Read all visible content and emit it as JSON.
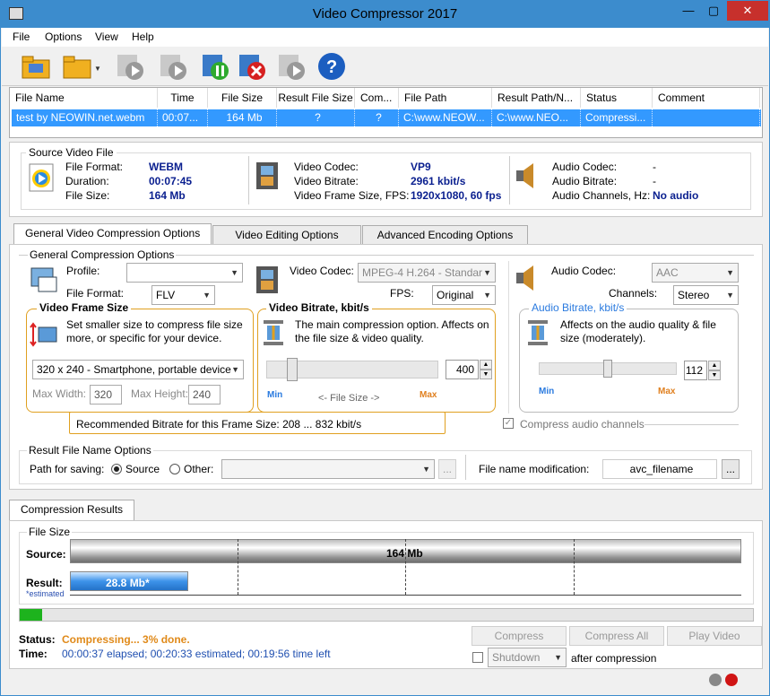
{
  "window": {
    "title": "Video Compressor 2017",
    "minimize": "—",
    "maximize": "▢",
    "close": "✕"
  },
  "menu": [
    "File",
    "Options",
    "View",
    "Help"
  ],
  "grid": {
    "columns": [
      "File Name",
      "Time",
      "File Size",
      "Result File Size",
      "Com...",
      "File Path",
      "Result Path/N...",
      "Status",
      "Comment"
    ],
    "row": [
      "test by NEOWIN.net.webm",
      "00:07...",
      "164 Mb",
      "?",
      "?",
      "C:\\www.NEOW...",
      "C:\\www.NEO...",
      "Compressi...",
      ""
    ]
  },
  "source": {
    "title": "Source Video File",
    "format_label": "File Format:",
    "format": "WEBM",
    "duration_label": "Duration:",
    "duration": "00:07:45",
    "size_label": "File Size:",
    "size": "164 Mb",
    "vcodec_label": "Video Codec:",
    "vcodec": "VP9",
    "vbitrate_label": "Video Bitrate:",
    "vbitrate": "2961 kbit/s",
    "vframe_label": "Video Frame Size, FPS:",
    "vframe": "1920x1080, 60 fps",
    "acodec_label": "Audio Codec:",
    "acodec": "-",
    "abitrate_label": "Audio Bitrate:",
    "abitrate": "-",
    "achannels_label": "Audio Channels, Hz:",
    "achannels": "No audio"
  },
  "tabs": [
    "General Video Compression Options",
    "Video Editing Options",
    "Advanced Encoding Options"
  ],
  "general": {
    "title": "General Compression Options",
    "profile_label": "Profile:",
    "profile_value": "",
    "format_label": "File Format:",
    "format_value": "FLV",
    "vcodec_label": "Video Codec:",
    "vcodec_value": "MPEG-4 H.264 - Standar",
    "fps_label": "FPS:",
    "fps_value": "Original",
    "acodec_label": "Audio Codec:",
    "acodec_value": "AAC",
    "channels_label": "Channels:",
    "channels_value": "Stereo"
  },
  "frame": {
    "title": "Video Frame Size",
    "desc": "Set smaller size to compress file size more, or specific for your device.",
    "preset": "320 x 240 - Smartphone, portable device",
    "maxw_label": "Max Width:",
    "maxw": "320",
    "maxh_label": "Max Height:",
    "maxh": "240"
  },
  "vbitrate": {
    "title": "Video Bitrate, kbit/s",
    "desc": "The main compression option. Affects on the file size & video quality.",
    "value": "400",
    "min": "Min",
    "max": "Max",
    "mid": "<-  File Size  ->",
    "level": 0.08
  },
  "abitrate": {
    "title": "Audio Bitrate, kbit/s",
    "desc": "Affects on the audio quality & file size (moderately).",
    "value": "112",
    "min": "Min",
    "max": "Max",
    "level": 0.5
  },
  "recommended": "Recommended Bitrate for this Frame Size: 208 ... 832 kbit/s",
  "compress_audio": "Compress audio channels",
  "result_name": {
    "title": "Result File Name Options",
    "path_label": "Path for saving:",
    "source": "Source",
    "other": "Other:",
    "browse": "...",
    "mod_label": "File name modification:",
    "mod_value": "avc_filename"
  },
  "results": {
    "tab": "Compression Results",
    "group": "File Size",
    "source_label": "Source:",
    "source_value": "164 Mb",
    "result_label": "Result:",
    "result_value": "28.8 Mb*",
    "estimated": "*estimated",
    "result_fraction": 0.176,
    "progress": 0.03
  },
  "status": {
    "status_label": "Status:",
    "status_value": "Compressing... 3% done.",
    "time_label": "Time:",
    "time_value": "00:00:37 elapsed;  00:20:33 estimated;  00:19:56 time left"
  },
  "actions": {
    "compress": "Compress",
    "compress_all": "Compress All",
    "play": "Play Video",
    "shutdown": "Shutdown",
    "after": "after compression"
  },
  "colors": {
    "accent": "#3c8ccd",
    "selection": "#3399ff",
    "orange": "#e0a020",
    "progress": "#1db31d"
  }
}
